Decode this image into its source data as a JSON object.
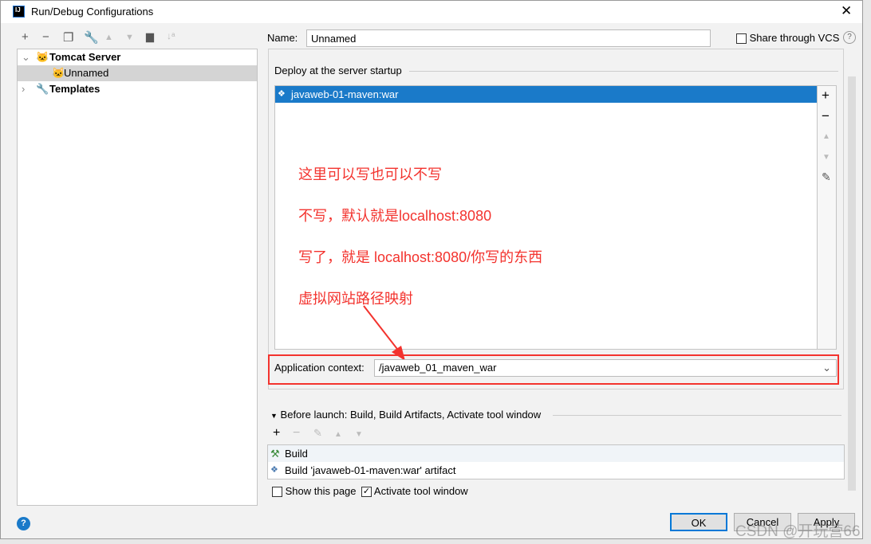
{
  "window": {
    "title": "Run/Debug Configurations",
    "logo": "IJ"
  },
  "toolbar": {
    "icons": [
      "plus-icon",
      "minus-icon",
      "copy-icon",
      "wrench-icon",
      "arrow-up-icon",
      "arrow-down-icon",
      "folder-add-icon",
      "sort-icon"
    ]
  },
  "tree": {
    "items": [
      {
        "label": "Tomcat Server"
      },
      {
        "label": "Unnamed"
      },
      {
        "label": "Templates"
      }
    ]
  },
  "name": {
    "label": "Name:",
    "value": "Unnamed"
  },
  "share": {
    "label": "Share through VCS",
    "checked": false
  },
  "deploy": {
    "title": "Deploy at the server startup",
    "artifacts": [
      "javaweb-01-maven:war"
    ]
  },
  "annotations": [
    "这里可以写也可以不写",
    "不写，默认就是localhost:8080",
    "写了，就是 localhost:8080/你写的东西",
    "虚拟网站路径映射"
  ],
  "context": {
    "label": "Application context:",
    "value": "/javaweb_01_maven_war"
  },
  "before_launch": {
    "title": "Before launch: Build, Build Artifacts, Activate tool window",
    "tasks": [
      "Build",
      "Build 'javaweb-01-maven:war' artifact"
    ]
  },
  "options": {
    "show_page": {
      "label": "Show this page",
      "checked": false
    },
    "activate": {
      "label": "Activate tool window",
      "checked": true
    }
  },
  "buttons": {
    "ok": "OK",
    "cancel": "Cancel",
    "apply": "Apply",
    "help": "?"
  },
  "watermark": "CSDN @开玩营66",
  "colors": {
    "selection": "#1a7ac9",
    "annotation": "#f3332e",
    "ok_border": "#0078d7"
  }
}
